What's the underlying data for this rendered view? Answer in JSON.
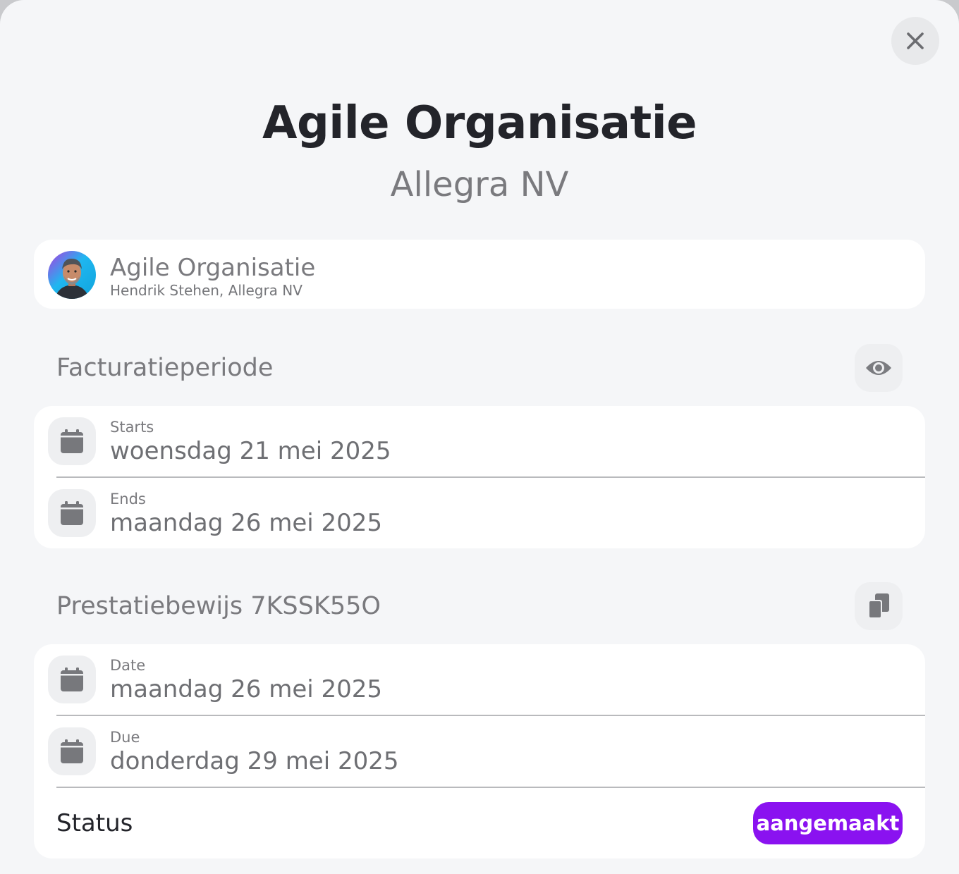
{
  "modal": {
    "title": "Agile Organisatie",
    "subtitle": "Allegra NV",
    "close_icon": "close-icon"
  },
  "contact": {
    "name": "Agile Organisatie",
    "subline": "Hendrik Stehen, Allegra NV",
    "avatar": "avatar-photo"
  },
  "billing_period": {
    "title": "Facturatieperiode",
    "action_icon": "eye-icon",
    "rows": [
      {
        "label": "Starts",
        "value": "woensdag 21 mei 2025",
        "icon": "calendar-icon"
      },
      {
        "label": "Ends",
        "value": "maandag 26 mei 2025",
        "icon": "calendar-icon"
      }
    ]
  },
  "proof": {
    "title": "Prestatiebewijs 7KSSK55O",
    "action_icon": "copy-icon",
    "rows": [
      {
        "label": "Date",
        "value": "maandag 26 mei 2025",
        "icon": "calendar-icon"
      },
      {
        "label": "Due",
        "value": "donderdag 29 mei 2025",
        "icon": "calendar-icon"
      }
    ],
    "status_label": "Status",
    "status_value": "aangemaakt"
  },
  "colors": {
    "accent": "#8a12f0",
    "background": "#f5f6f8",
    "card": "#ffffff",
    "text_dark": "#23242a",
    "text_muted": "#7a7a7e"
  }
}
